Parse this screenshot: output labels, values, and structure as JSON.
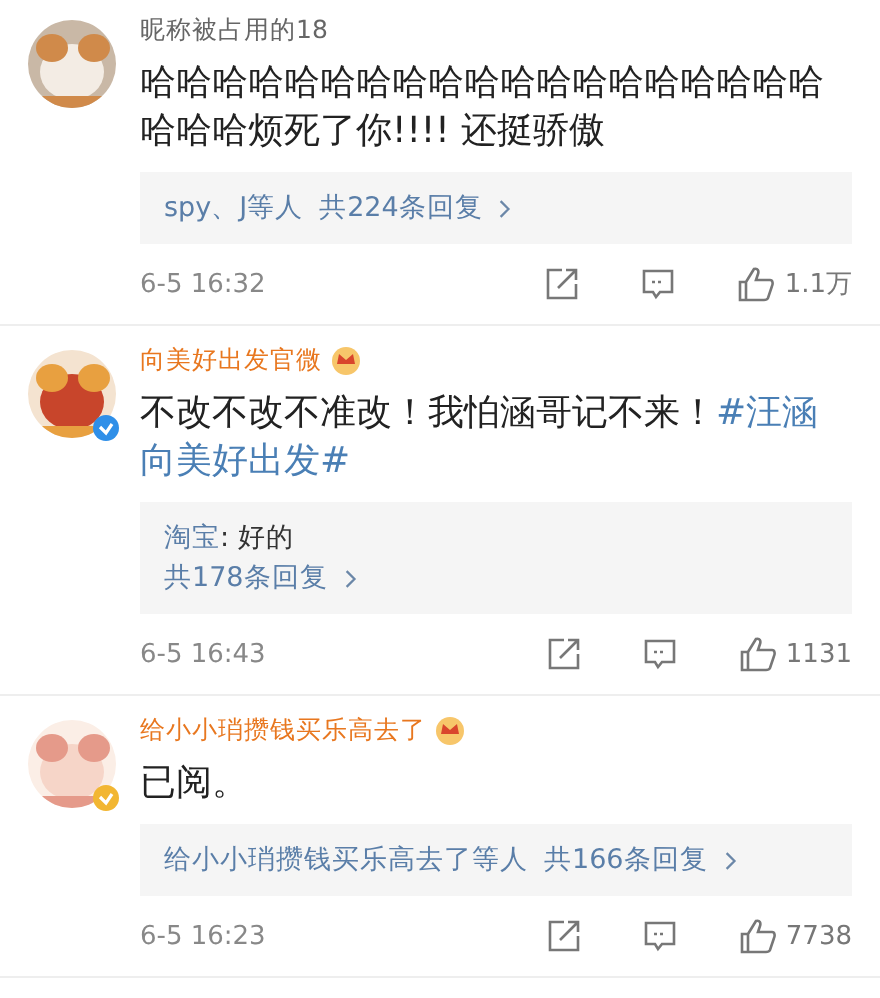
{
  "comments": [
    {
      "name": "昵称被占用的18",
      "vip": false,
      "segments": [
        {
          "kind": "plain",
          "text": "哈哈哈哈哈哈哈哈哈哈哈哈哈哈哈哈哈哈哈哈哈哈烦死了你!!!! 还挺骄傲"
        }
      ],
      "replies": {
        "participants": "spy、J等人",
        "total": "共224条回复"
      },
      "time": "6-5 16:32",
      "likes": "1.1万"
    },
    {
      "name": "向美好出发官微",
      "vip": true,
      "verified": {
        "color": "#2f8fe8"
      },
      "segments": [
        {
          "kind": "plain",
          "text": "不改不改不准改！我怕涵哥记不来！"
        },
        {
          "kind": "topic",
          "text": "#汪涵向美好出发#"
        }
      ],
      "replies": {
        "preview": [
          {
            "author": "淘宝",
            "text": ": 好的"
          }
        ],
        "total": "共178条回复"
      },
      "time": "6-5 16:43",
      "likes": "1131"
    },
    {
      "name": "给小小琑攒钱买乐高去了",
      "vip": true,
      "verified": {
        "color": "#f2b632"
      },
      "segments": [
        {
          "kind": "plain",
          "text": "已阅。"
        }
      ],
      "replies": {
        "participants": "给小小琑攒钱买乐高去了等人",
        "total": "共166条回复"
      },
      "time": "6-5 16:23",
      "likes": "7738"
    }
  ]
}
